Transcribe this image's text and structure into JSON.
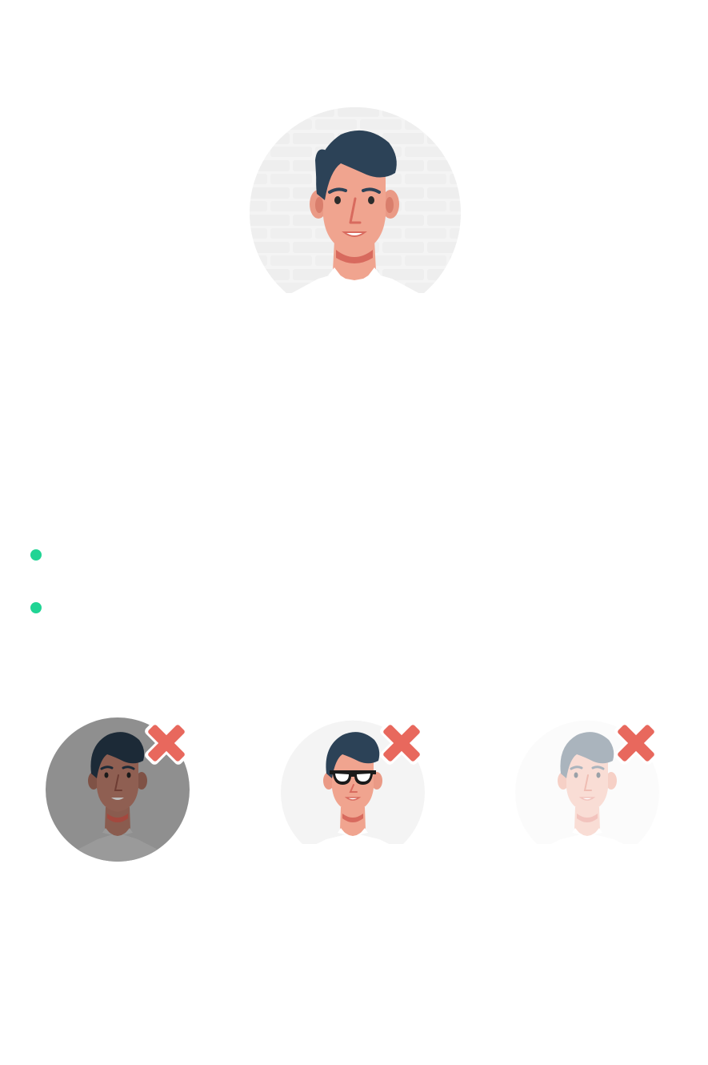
{
  "colors": {
    "accent_bullet": "#20d494",
    "reject_mark": "#e8685d",
    "hair": "#2c4257",
    "skin": "#f0a48f"
  },
  "hero": {
    "icon": "profile-photo-illustration"
  },
  "guidelines": [
    {
      "icon": "bullet-dot",
      "text": ""
    },
    {
      "icon": "bullet-dot",
      "text": ""
    }
  ],
  "examples": [
    {
      "icon": "dark-photo-example",
      "status": "rejected",
      "status_icon": "red-x-icon"
    },
    {
      "icon": "sunglasses-photo-example",
      "status": "rejected",
      "status_icon": "red-x-icon"
    },
    {
      "icon": "faded-photo-example",
      "status": "rejected",
      "status_icon": "red-x-icon"
    }
  ]
}
